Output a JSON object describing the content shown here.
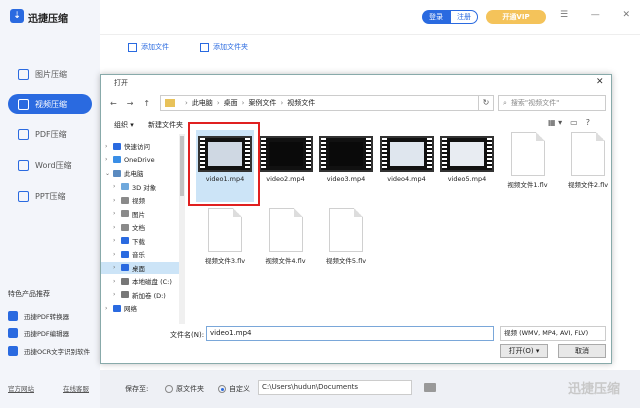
{
  "app": {
    "title": "迅捷压缩",
    "login": "登录",
    "register": "注册",
    "vip": "开通VIP",
    "win_controls": [
      "☰",
      "—",
      "✕"
    ]
  },
  "sidebar": {
    "items": [
      {
        "label": "图片压缩"
      },
      {
        "label": "视频压缩"
      },
      {
        "label": "PDF压缩"
      },
      {
        "label": "Word压缩"
      },
      {
        "label": "PPT压缩"
      }
    ],
    "section_title": "特色产品推荐",
    "features": [
      {
        "label": "迅捷PDF转换器"
      },
      {
        "label": "迅捷PDF编辑器"
      },
      {
        "label": "迅捷OCR文字识别软件"
      }
    ],
    "site_link": "官方网站",
    "online_link": "在线客服"
  },
  "toolbar": {
    "add_file": "添加文件",
    "add_folder": "添加文件夹"
  },
  "bottom": {
    "save_to": "保存至:",
    "opt_original": "原文件夹",
    "opt_custom": "自定义",
    "save_path": "C:\\Users\\hudun\\Documents",
    "watermark": "迅捷压缩"
  },
  "dialog": {
    "title": "打开",
    "close": "✕",
    "nav": [
      "←",
      "→",
      "↑"
    ],
    "breadcrumb": [
      "此电脑",
      "桌面",
      "案例文件",
      "视频文件"
    ],
    "refresh": "↻",
    "search_placeholder": "搜索\"视频文件\"",
    "organize": "组织 ▾",
    "new_folder": "新建文件夹",
    "view_icons": [
      "▦ ▾",
      "▭",
      "?"
    ],
    "tree": [
      {
        "label": "快速访问",
        "color": "#2a6ae0",
        "chev": "›",
        "indent": 0
      },
      {
        "label": "OneDrive",
        "color": "#3a8ee6",
        "chev": "›",
        "indent": 0
      },
      {
        "label": "此电脑",
        "color": "#5a8ac0",
        "chev": "⌄",
        "indent": 0
      },
      {
        "label": "3D 对象",
        "color": "#6fa8dc",
        "chev": "›",
        "indent": 1
      },
      {
        "label": "视频",
        "color": "#8a8a8a",
        "chev": "›",
        "indent": 1
      },
      {
        "label": "图片",
        "color": "#8a8a8a",
        "chev": "›",
        "indent": 1
      },
      {
        "label": "文档",
        "color": "#8a8a8a",
        "chev": "›",
        "indent": 1
      },
      {
        "label": "下载",
        "color": "#2a6ae0",
        "chev": "›",
        "indent": 1
      },
      {
        "label": "音乐",
        "color": "#2a6ae0",
        "chev": "›",
        "indent": 1
      },
      {
        "label": "桌面",
        "color": "#2a6ae0",
        "chev": "›",
        "indent": 1,
        "selected": true
      },
      {
        "label": "本地磁盘 (C:)",
        "color": "#777",
        "chev": "›",
        "indent": 1
      },
      {
        "label": "新加卷 (D:)",
        "color": "#777",
        "chev": "›",
        "indent": 1
      },
      {
        "label": "网络",
        "color": "#2a6ae0",
        "chev": "›",
        "indent": 0
      }
    ],
    "files": [
      {
        "name": "video1.mp4",
        "kind": "video",
        "screen": "#cfd8e3"
      },
      {
        "name": "video2.mp4",
        "kind": "video",
        "screen": "#0a0a0a"
      },
      {
        "name": "video3.mp4",
        "kind": "video",
        "screen": "#0a0a0a"
      },
      {
        "name": "video4.mp4",
        "kind": "video",
        "screen": "#dfe6ee"
      },
      {
        "name": "video5.mp4",
        "kind": "video",
        "screen": "#e8ecf2"
      },
      {
        "name": "视频文件1.flv",
        "kind": "doc"
      },
      {
        "name": "视频文件2.flv",
        "kind": "doc"
      },
      {
        "name": "视频文件3.flv",
        "kind": "doc"
      },
      {
        "name": "视频文件4.flv",
        "kind": "doc"
      },
      {
        "name": "视频文件5.flv",
        "kind": "doc"
      }
    ],
    "filename_label": "文件名(N):",
    "filename_value": "video1.mp4",
    "filetype": "视频 (WMV, MP4, AVI, FLV)",
    "open": "打开(O)",
    "open_arrow": "▾",
    "cancel": "取消"
  }
}
